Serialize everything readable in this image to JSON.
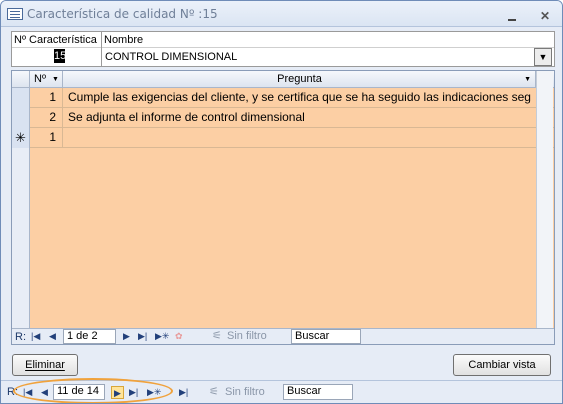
{
  "window": {
    "title": "Característica de calidad Nº :15",
    "icon": "form-icon"
  },
  "header": {
    "num_label": "Nº Característica",
    "name_label": "Nombre",
    "num_value": "15",
    "name_value": "CONTROL DIMENSIONAL"
  },
  "grid": {
    "col_num": "Nº",
    "col_pregunta": "Pregunta",
    "rows": [
      {
        "n": "1",
        "p": "Cumple las exigencias del cliente, y se certifica que se ha seguido las indicaciones seg"
      },
      {
        "n": "2",
        "p": "Se adjunta el informe de control dimensional"
      }
    ],
    "new_row": {
      "marker": "✳",
      "n": "1"
    },
    "nav": {
      "label": "R:",
      "record": "1 de 2",
      "filter": "Sin filtro",
      "search": "Buscar"
    }
  },
  "buttons": {
    "eliminar": "Eliminar",
    "cambiar_vista": "Cambiar vista"
  },
  "main_nav": {
    "label": "R:",
    "record": "11 de 14",
    "filter": "Sin filtro",
    "search": "Buscar"
  },
  "colors": {
    "grid_bg": "#fccfa4",
    "highlight_oval": "#f0a23c"
  }
}
